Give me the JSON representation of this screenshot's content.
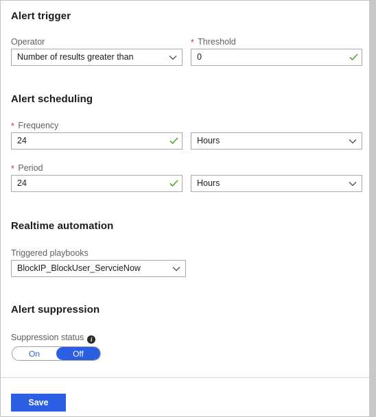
{
  "sections": {
    "alert_trigger": {
      "title": "Alert trigger",
      "operator": {
        "label": "Operator",
        "value": "Number of results greater than"
      },
      "threshold": {
        "label": "Threshold",
        "value": "0",
        "required_marker": "*"
      }
    },
    "alert_scheduling": {
      "title": "Alert scheduling",
      "frequency": {
        "label": "Frequency",
        "value": "24",
        "unit": "Hours",
        "required_marker": "*"
      },
      "period": {
        "label": "Period",
        "value": "24",
        "unit": "Hours",
        "required_marker": "*"
      }
    },
    "realtime_automation": {
      "title": "Realtime automation",
      "playbooks": {
        "label": "Triggered playbooks",
        "value": "BlockIP_BlockUser_ServcieNow"
      }
    },
    "alert_suppression": {
      "title": "Alert suppression",
      "suppression_status": {
        "label": "Suppression status",
        "info_glyph": "i",
        "options": [
          "On",
          "Off"
        ],
        "selected": "Off"
      }
    }
  },
  "footer": {
    "save_label": "Save"
  },
  "colors": {
    "accent": "#2b5fe3",
    "required_star": "#d13438",
    "valid_check": "#4bab2c",
    "label_text": "#616161",
    "value_text": "#1b1b1b",
    "control_border": "#a6a6a6",
    "panel_border": "#bfbfbf"
  }
}
